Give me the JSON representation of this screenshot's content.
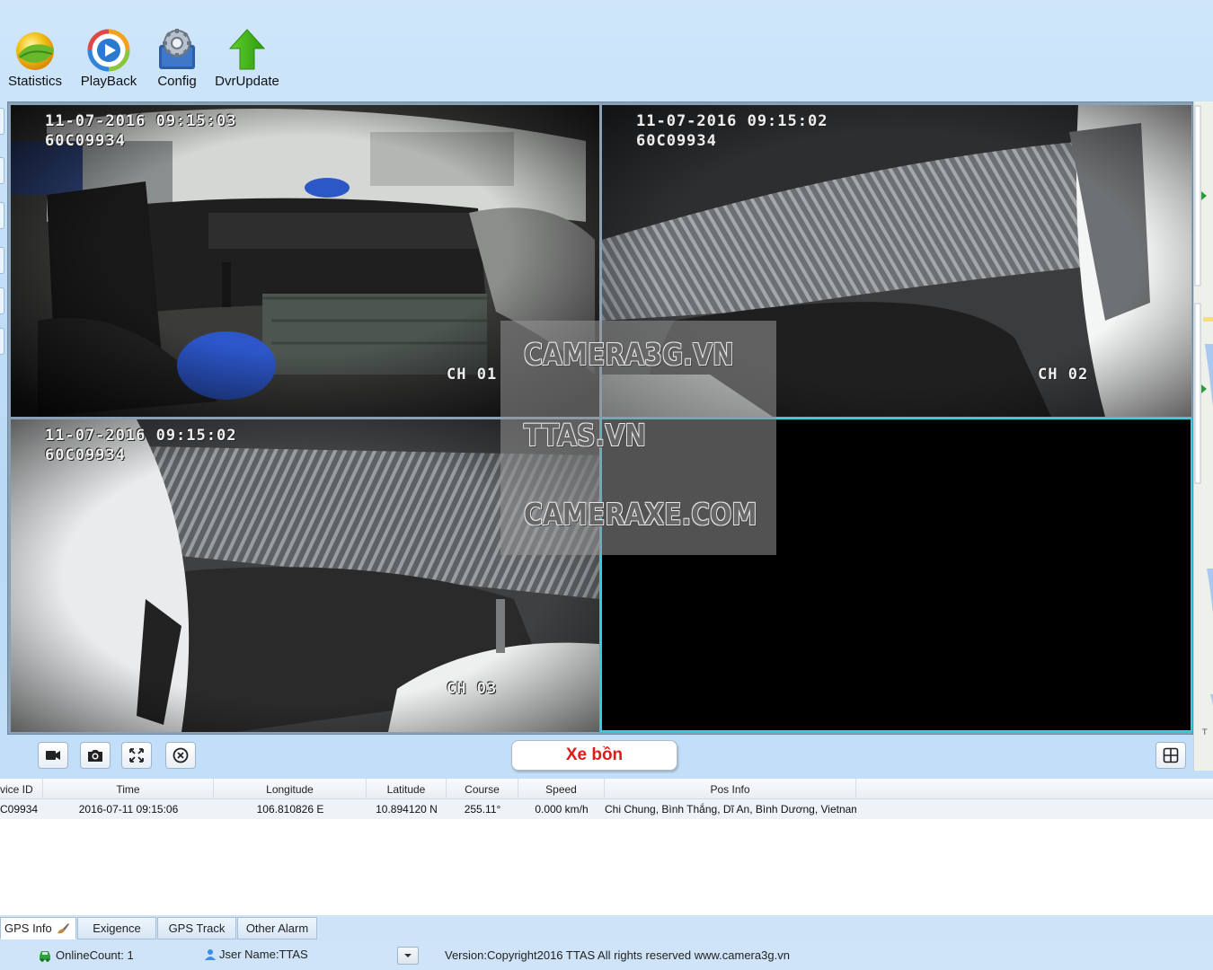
{
  "toolbar": {
    "items": [
      {
        "label": "Statistics",
        "icon": "statistics-icon"
      },
      {
        "label": "PlayBack",
        "icon": "playback-icon"
      },
      {
        "label": "Config",
        "icon": "config-icon"
      },
      {
        "label": "DvrUpdate",
        "icon": "dvrupdate-icon"
      }
    ]
  },
  "video": {
    "channels": [
      {
        "datetime": "11-07-2016 09:15:03",
        "plate": "60C09934",
        "channel": "CH 01"
      },
      {
        "datetime": "11-07-2016 09:15:02",
        "plate": "60C09934",
        "channel": "CH 02"
      },
      {
        "datetime": "11-07-2016 09:15:02",
        "plate": "60C09934",
        "channel": "CH 03"
      },
      {
        "datetime": "",
        "plate": "",
        "channel": ""
      }
    ],
    "watermark": [
      "CAMERA3G.VN",
      "TTAS.VN",
      "CAMERAXE.COM"
    ]
  },
  "controls": {
    "vehicle_name": "Xe bồn",
    "icons": [
      "record-icon",
      "snapshot-icon",
      "fullscreen-icon",
      "close-all-icon",
      "grid-layout-icon"
    ]
  },
  "table": {
    "headers": [
      "vice ID",
      "Time",
      "Longitude",
      "Latitude",
      "Course",
      "Speed",
      "Pos Info"
    ],
    "rows": [
      [
        "C09934",
        "2016-07-11 09:15:06",
        "106.810826 E",
        "10.894120 N",
        "255.11°",
        "0.000 km/h",
        "Chi Chung, Bình Thắng, Dĩ An, Bình Dương, Vietnam"
      ]
    ]
  },
  "tabs": [
    "GPS Info",
    "Exigence",
    "GPS Track",
    "Other Alarm"
  ],
  "status": {
    "online_count": "OnlineCount: 1",
    "user_name": "Jser Name:TTAS",
    "version": "Version:Copyright2016 TTAS All rights reserved www.camera3g.vn"
  },
  "colors": {
    "vehicle_name": "#e01b1b",
    "selected_pane": "#2fd0e0",
    "background": "#c3def7"
  }
}
